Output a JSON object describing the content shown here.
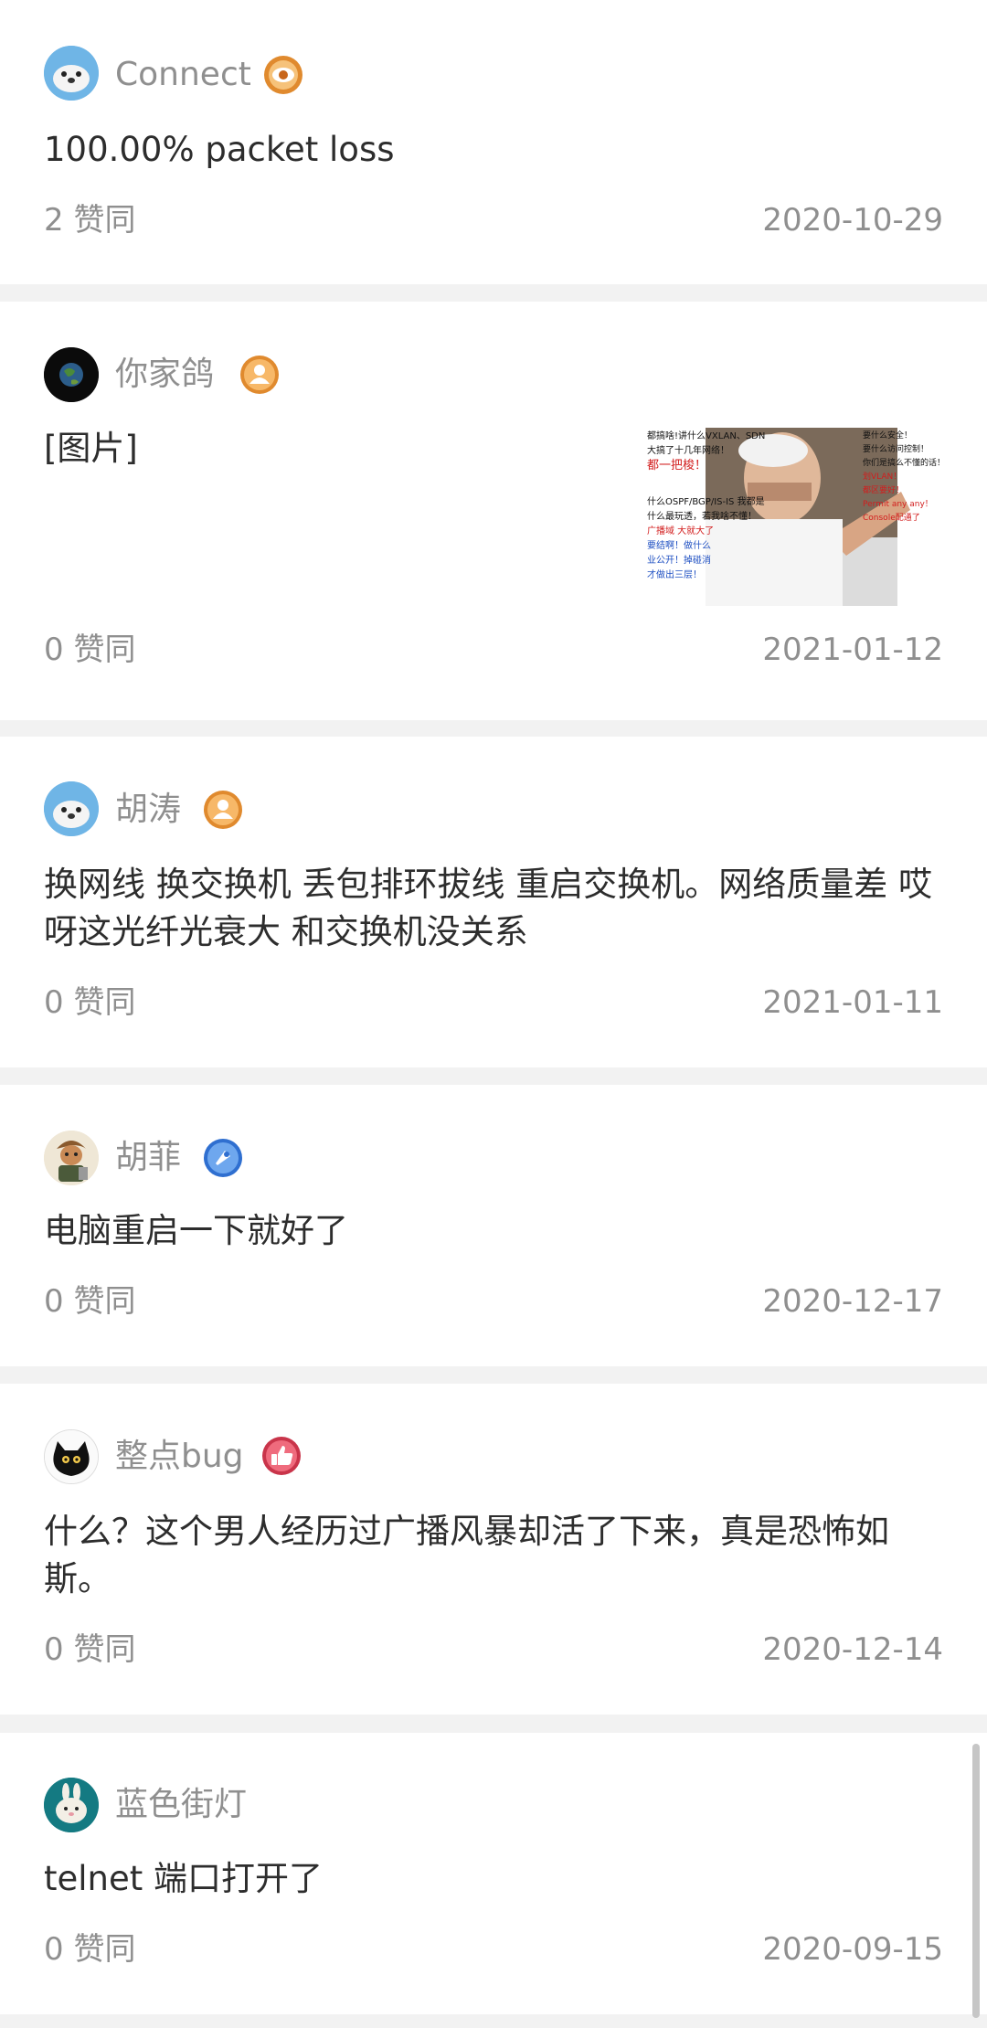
{
  "comments": [
    {
      "username": "Connect",
      "avatar": "seal-avatar",
      "badge": "eye-badge-icon",
      "text": "100.00% packet loss",
      "likes": "2 赞同",
      "date": "2020-10-29"
    },
    {
      "username": "你家鸽",
      "avatar": "globe-avatar",
      "badge": "person-badge-icon",
      "text": "[图片]",
      "image_text": {
        "left_lines": [
          "都搞啥!讲什么VXLAN、SDN",
          "大搞了十几年网络！",
          "都一把梭！"
        ],
        "left_lines2": [
          "什么OSPF/BGP/IS-IS 我都是",
          "什么最玩透，若我啥不懂！",
          "广播域 大就大了"
        ],
        "left_lines3": [
          "要结啊！做什么",
          "业公开！掉碰消",
          "才做出三层！"
        ],
        "right_lines": [
          "要什么安全！",
          "要什么访问控制！",
          "你们是搞么不懂的话！",
          "划VLAN！",
          "都区要好！",
          "Permit any any！",
          "Console配通了"
        ]
      },
      "likes": "0 赞同",
      "date": "2021-01-12"
    },
    {
      "username": "胡涛",
      "avatar": "seal-avatar",
      "badge": "person-badge-icon",
      "text": "换网线 换交换机 丢包排环拔线 重启交换机。网络质量差 哎呀这光纤光衰大 和交换机没关系",
      "likes": "0 赞同",
      "date": "2021-01-11"
    },
    {
      "username": "胡菲",
      "avatar": "cartoon-character-avatar",
      "badge": "blue-rocket-badge-icon",
      "text": "电脑重启一下就好了",
      "likes": "0 赞同",
      "date": "2020-12-17"
    },
    {
      "username": "整点bug",
      "avatar": "black-cat-avatar",
      "badge": "thumbs-up-badge-icon",
      "text": "什么？这个男人经历过广播风暴却活了下来，真是恐怖如斯。",
      "likes": "0 赞同",
      "date": "2020-12-14"
    },
    {
      "username": "蓝色街灯",
      "avatar": "rabbit-avatar",
      "text": "telnet 端口打开了",
      "likes": "0 赞同",
      "date": "2020-09-15"
    }
  ]
}
